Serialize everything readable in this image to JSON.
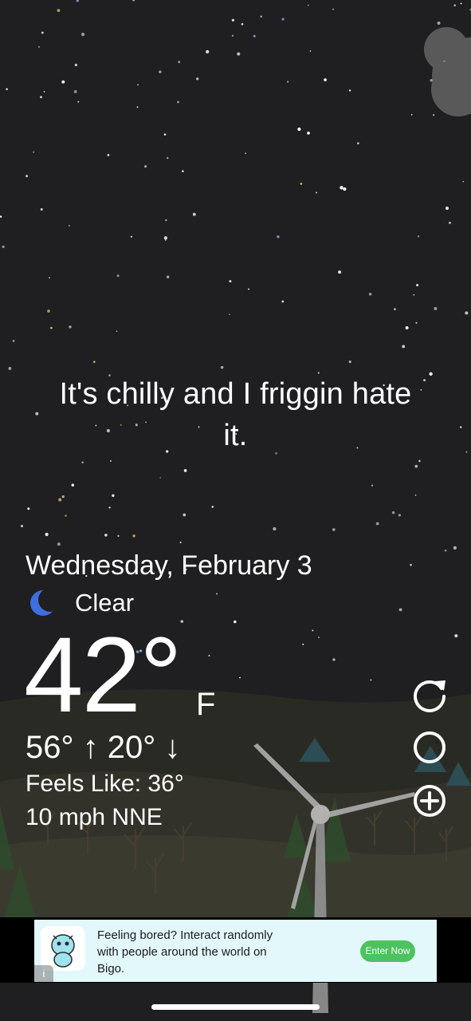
{
  "headline": "It's chilly and I friggin hate it.",
  "weather": {
    "date": "Wednesday, February 3",
    "condition": "Clear",
    "condition_icon": "moon-icon",
    "temperature": "42°",
    "unit": "F",
    "hi_lo": "56° ↑  20° ↓",
    "feels_like": "Feels Like: 36°",
    "wind": "10 mph NNE"
  },
  "side_actions": [
    "refresh-icon",
    "moon-phase-icon",
    "add-icon"
  ],
  "ad": {
    "text": "Feeling bored? Interact randomly with people around the world on Bigo.",
    "cta": "Enter Now",
    "info": "i",
    "icon": "bigo-logo"
  },
  "colors": {
    "sky": "#1f1f21",
    "ad_background": "#e3f8fb",
    "cta": "#4cc35e",
    "moon": "#3d6fe0"
  }
}
